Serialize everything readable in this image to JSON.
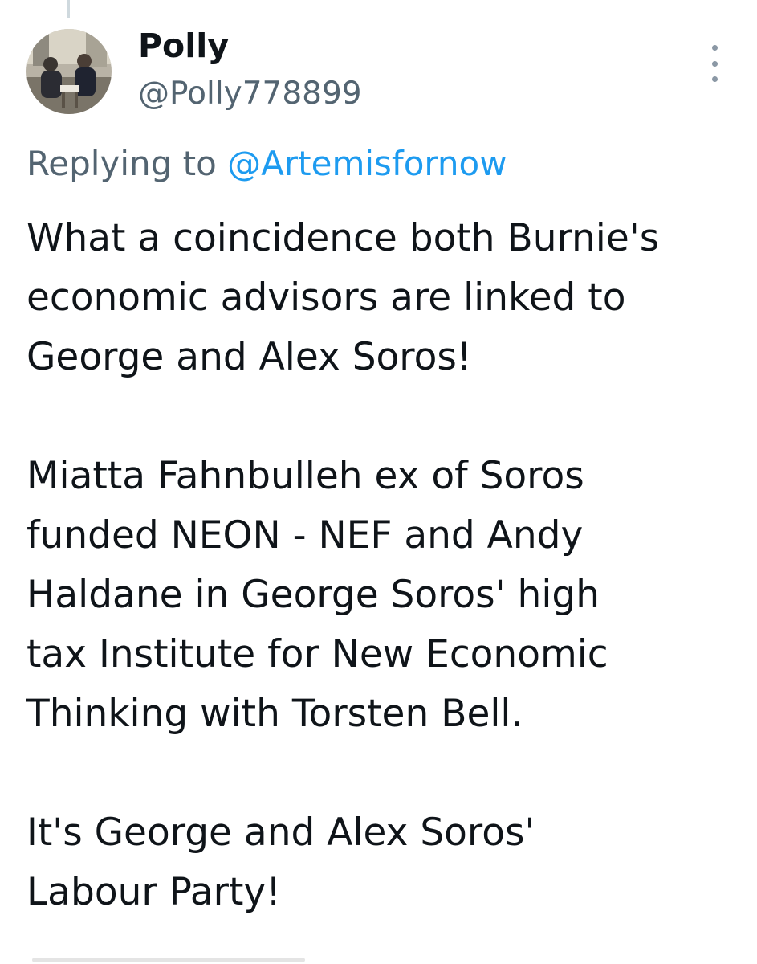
{
  "tweet": {
    "author": {
      "display_name": "Polly",
      "handle": "@Polly778899",
      "avatar_alt": "avatar"
    },
    "reply": {
      "prefix": "Replying to ",
      "mention": "@Artemisfornow"
    },
    "paragraphs": [
      {
        "lines": [
          "What a coincidence both Burnie's",
          "economic advisors are linked to",
          "George and Alex Soros!"
        ]
      },
      {
        "lines": [
          "Miatta Fahnbulleh ex of Soros",
          "funded NEON - NEF and Andy",
          "Haldane in George Soros' high",
          "tax Institute for New Economic",
          "Thinking with Torsten Bell."
        ]
      },
      {
        "lines": [
          "It's George and Alex Soros'",
          "Labour Party!"
        ]
      }
    ]
  },
  "icons": {
    "more": "more-vertical-icon"
  },
  "colors": {
    "text_primary": "#0f1419",
    "text_secondary": "#536471",
    "link": "#1d9bf0"
  }
}
